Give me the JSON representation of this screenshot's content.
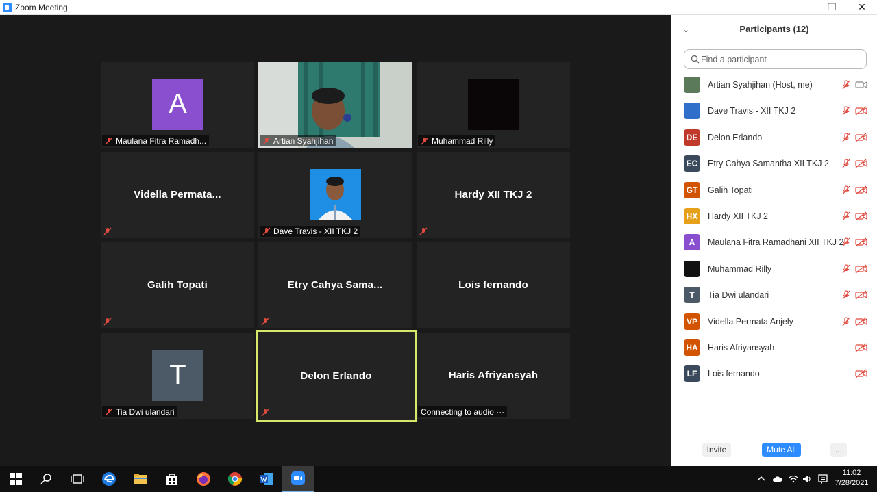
{
  "window": {
    "title": "Zoom Meeting",
    "min": "—",
    "max": "❐",
    "close": "✕"
  },
  "tiles": [
    {
      "label": "Maulana Fitra Ramadh...",
      "avatar": "A",
      "avatar_color": "#8a4fcf"
    },
    {
      "label": "Artian Syahjihan"
    },
    {
      "label": "Muhammad Rilly"
    },
    {
      "bigname": "Vidella  Permata..."
    },
    {
      "label": "Dave Travis - XII TKJ 2"
    },
    {
      "bigname": "Hardy XII TKJ 2"
    },
    {
      "bigname": "Galih Topati"
    },
    {
      "bigname": "Etry Cahya Sama..."
    },
    {
      "bigname": "Lois fernando"
    },
    {
      "label": "Tia Dwi ulandari",
      "avatar": "T",
      "avatar_color": "#4b5a66"
    },
    {
      "bigname": "Delon Erlando"
    },
    {
      "bigname": "Haris Afriyansyah",
      "label": "Connecting to audio ···"
    }
  ],
  "panel": {
    "title": "Participants (12)",
    "search_placeholder": "Find a participant",
    "participants": [
      {
        "name": "Artian Syahjihan (Host, me)",
        "initials": "",
        "color": "#5a7a5a",
        "mic": "muted",
        "video": "on"
      },
      {
        "name": "Dave Travis - XII TKJ 2",
        "initials": "",
        "color": "#2f6fc9",
        "mic": "muted",
        "video": "off"
      },
      {
        "name": "Delon Erlando",
        "initials": "DE",
        "color": "#c0392b",
        "mic": "muted",
        "video": "off"
      },
      {
        "name": "Etry Cahya Samantha XII TKJ 2",
        "initials": "EC",
        "color": "#3a4a5c",
        "mic": "muted",
        "video": "off"
      },
      {
        "name": "Galih Topati",
        "initials": "GT",
        "color": "#d35400",
        "mic": "muted",
        "video": "off"
      },
      {
        "name": "Hardy XII TKJ 2",
        "initials": "HX",
        "color": "#e6a019",
        "mic": "muted",
        "video": "off"
      },
      {
        "name": "Maulana Fitra Ramadhani XII TKJ 2",
        "initials": "A",
        "color": "#8a4fcf",
        "mic": "muted",
        "video": "off"
      },
      {
        "name": "Muhammad Rilly",
        "initials": "",
        "color": "#111111",
        "mic": "muted",
        "video": "off"
      },
      {
        "name": "Tia Dwi ulandari",
        "initials": "T",
        "color": "#4b5a66",
        "mic": "muted",
        "video": "off"
      },
      {
        "name": "Vidella Permata Anjely",
        "initials": "VP",
        "color": "#d35400",
        "mic": "muted",
        "video": "off"
      },
      {
        "name": "Haris Afriyansyah",
        "initials": "HA",
        "color": "#d35400",
        "mic": "none",
        "video": "off"
      },
      {
        "name": "Lois fernando",
        "initials": "LF",
        "color": "#3a4a5c",
        "mic": "none",
        "video": "off"
      }
    ],
    "invite_label": "Invite",
    "mute_all_label": "Mute All",
    "more_label": "..."
  },
  "taskbar": {
    "time": "11:02",
    "date": "7/28/2021"
  }
}
